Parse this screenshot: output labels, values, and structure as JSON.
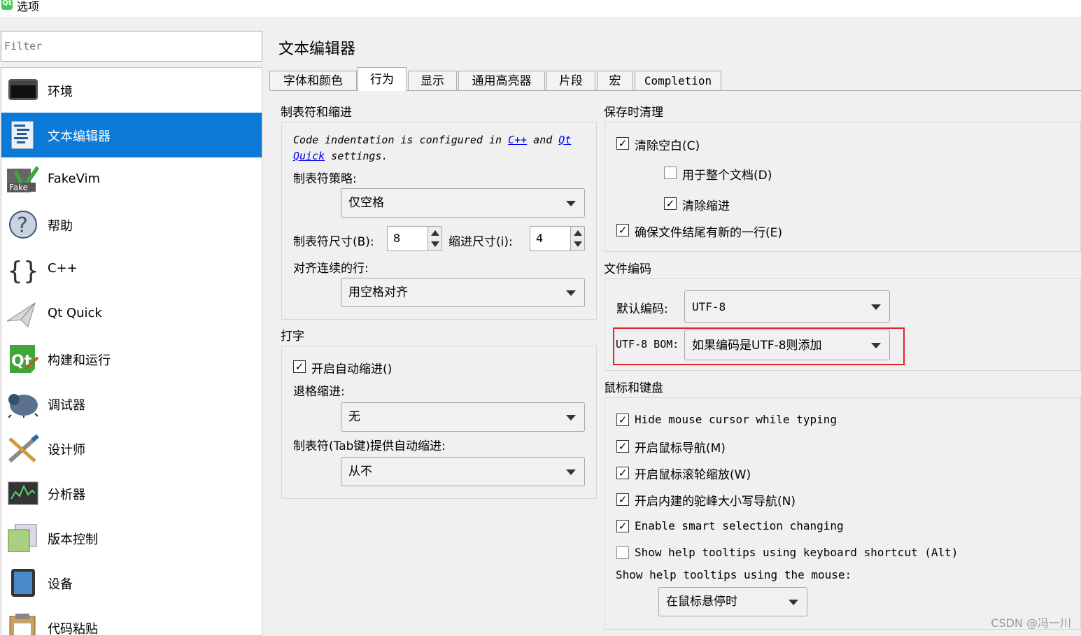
{
  "window": {
    "icon_text": "Qt",
    "title": "选项"
  },
  "filter": {
    "placeholder": "Filter"
  },
  "sidebar": {
    "items": [
      {
        "label": "环境"
      },
      {
        "label": "文本编辑器"
      },
      {
        "label": "FakeVim"
      },
      {
        "label": "帮助"
      },
      {
        "label": "C++"
      },
      {
        "label": "Qt Quick"
      },
      {
        "label": "构建和运行"
      },
      {
        "label": "调试器"
      },
      {
        "label": "设计师"
      },
      {
        "label": "分析器"
      },
      {
        "label": "版本控制"
      },
      {
        "label": "设备"
      },
      {
        "label": "代码粘贴"
      }
    ]
  },
  "page": {
    "title": "文本编辑器"
  },
  "tabs": [
    "字体和颜色",
    "行为",
    "显示",
    "通用高亮器",
    "片段",
    "宏",
    "Completion"
  ],
  "tabs_active": "行为",
  "tab_indent": {
    "title": "制表符和缩进",
    "note_pre": "Code indentation is configured in ",
    "note_link1": "C++",
    "note_mid": " and ",
    "note_link2a": "Qt",
    "note_link2b": "Quick",
    "note_post": " settings.",
    "policy_label": "制表符策略:",
    "policy_value": "仅空格",
    "tab_size_label": "制表符尺寸(B):",
    "tab_size_value": "8",
    "indent_size_label": "缩进尺寸(i):",
    "indent_size_value": "4",
    "align_label": "对齐连续的行:",
    "align_value": "用空格对齐"
  },
  "typing": {
    "title": "打字",
    "auto_indent_label": "开启自动缩进()",
    "backspace_label": "退格缩进:",
    "backspace_value": "无",
    "tab_key_label": "制表符(Tab键)提供自动缩进:",
    "tab_key_value": "从不"
  },
  "save_clean": {
    "title": "保存时清理",
    "clean_whitespace": "清除空白(C)",
    "entire_doc": "用于整个文档(D)",
    "clean_indent": "清除缩进",
    "newline_eof": "确保文件结尾有新的一行(E)"
  },
  "encoding": {
    "title": "文件编码",
    "default_label": "默认编码:",
    "default_value": "UTF-8",
    "bom_label": "UTF-8 BOM:",
    "bom_value": "如果编码是UTF-8则添加"
  },
  "mouse": {
    "title": "鼠标和键盘",
    "hide_cursor": "Hide mouse cursor while typing",
    "mouse_nav": "开启鼠标导航(M)",
    "wheel_zoom": "开启鼠标滚轮缩放(W)",
    "camel_nav": "开启内建的驼峰大小写导航(N)",
    "smart_selection": "Enable smart selection changing",
    "help_tooltips_keyboard": "Show help tooltips using keyboard shortcut (Alt)",
    "help_tooltips_mouse_label": "Show help tooltips using the mouse:",
    "help_tooltips_mouse_value": "在鼠标悬停时"
  },
  "check_glyph": "✓",
  "watermark": "CSDN @冯一川",
  "colors": {
    "selection": "#0b7ad6",
    "highlight_box": "#e5202a"
  }
}
